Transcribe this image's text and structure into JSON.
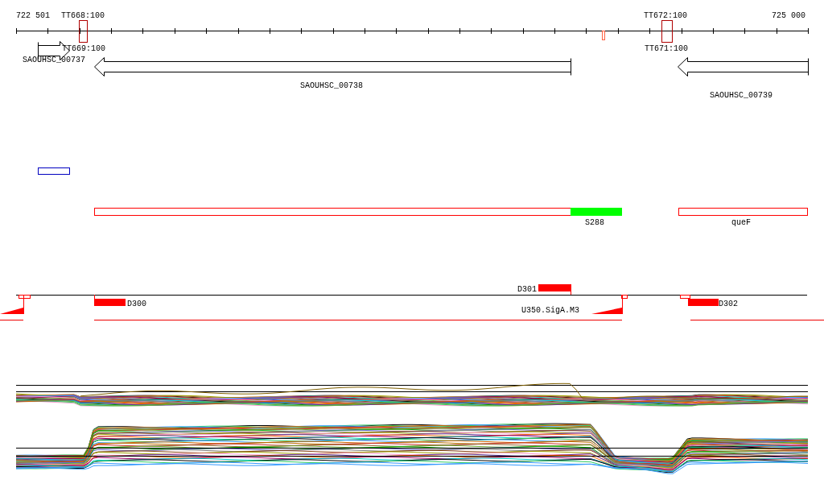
{
  "ruler": {
    "start_label": "722 501",
    "end_label": "725 000"
  },
  "terminators": [
    {
      "label_above": "TT668:100",
      "label_below": "TT669:100"
    },
    {
      "label_above": "TT672:100",
      "label_below": "TT671:100"
    }
  ],
  "genes": [
    {
      "name": "SAOUHSC_00737",
      "reverse": false
    },
    {
      "name": "SAOUHSC_00738",
      "reverse": true
    },
    {
      "name": "SAOUHSC_00739",
      "reverse": true
    }
  ],
  "segments": [
    {
      "kind": "outline",
      "color": "#ff0000"
    },
    {
      "kind": "filled",
      "color": "#00ff00",
      "label": "S288"
    },
    {
      "kind": "outline",
      "color": "#ff0000",
      "label": "queF"
    }
  ],
  "promoters": [
    {
      "label": "D300"
    },
    {
      "label": "D301"
    },
    {
      "label": "D302"
    }
  ],
  "sigma_sites": [
    {
      "label": "U350.SigA.M3"
    }
  ]
}
